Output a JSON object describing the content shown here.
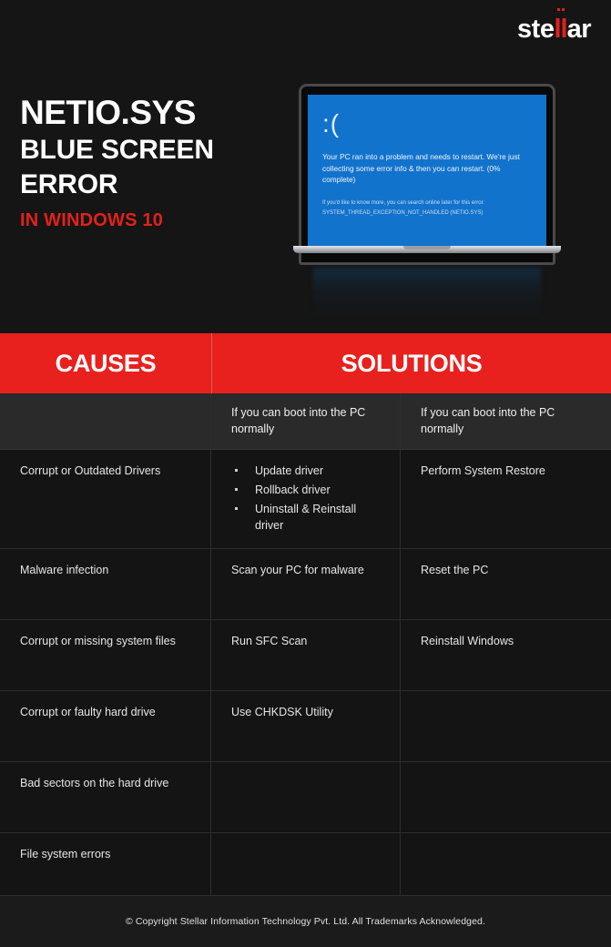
{
  "brand": {
    "logo_prefix": "ste",
    "logo_accent": "ll",
    "logo_suffix": "ar",
    "accent_color": "#e2211c"
  },
  "hero": {
    "title_line1": "NETIO.SYS",
    "title_line2": "BLUE SCREEN",
    "title_line3": "ERROR",
    "subtitle": "IN WINDOWS 10"
  },
  "bsod": {
    "face": ":(",
    "message": "Your PC ran into a problem and needs to restart. We're just collecting some error info & then you can restart. (0% complete)",
    "more_info": "If you'd like to know more, you can search online later for this error.",
    "error_code": "SYSTEM_THREAD_EXCEPTION_NOT_HANDLED (NETIO.SYS)",
    "screen_color": "#1273cd"
  },
  "table": {
    "header": {
      "causes": "CAUSES",
      "solutions": "SOLUTIONS",
      "header_bg": "#e8211e"
    },
    "subheader": {
      "col1": "",
      "col2": "If you can boot into the PC normally",
      "col3": "If you can boot into the PC normally"
    },
    "rows": [
      {
        "cause": "Corrupt or Outdated Drivers",
        "solution_bullets": [
          "Update driver",
          "Rollback driver",
          "Uninstall & Reinstall driver"
        ],
        "solution2": "Perform System Restore"
      },
      {
        "cause": "Malware infection",
        "solution": "Scan your PC for malware",
        "solution2": "Reset the PC"
      },
      {
        "cause": "Corrupt or missing system files",
        "solution": "Run SFC Scan",
        "solution2": "Reinstall Windows"
      },
      {
        "cause": "Corrupt or faulty hard drive",
        "solution": "Use CHKDSK Utility",
        "solution2": ""
      },
      {
        "cause": "Bad sectors on the hard drive",
        "solution": "",
        "solution2": ""
      },
      {
        "cause": "File system errors",
        "solution": "",
        "solution2": ""
      }
    ]
  },
  "footer": {
    "copyright": "© Copyright Stellar Information Technology Pvt. Ltd. All Trademarks Acknowledged."
  }
}
